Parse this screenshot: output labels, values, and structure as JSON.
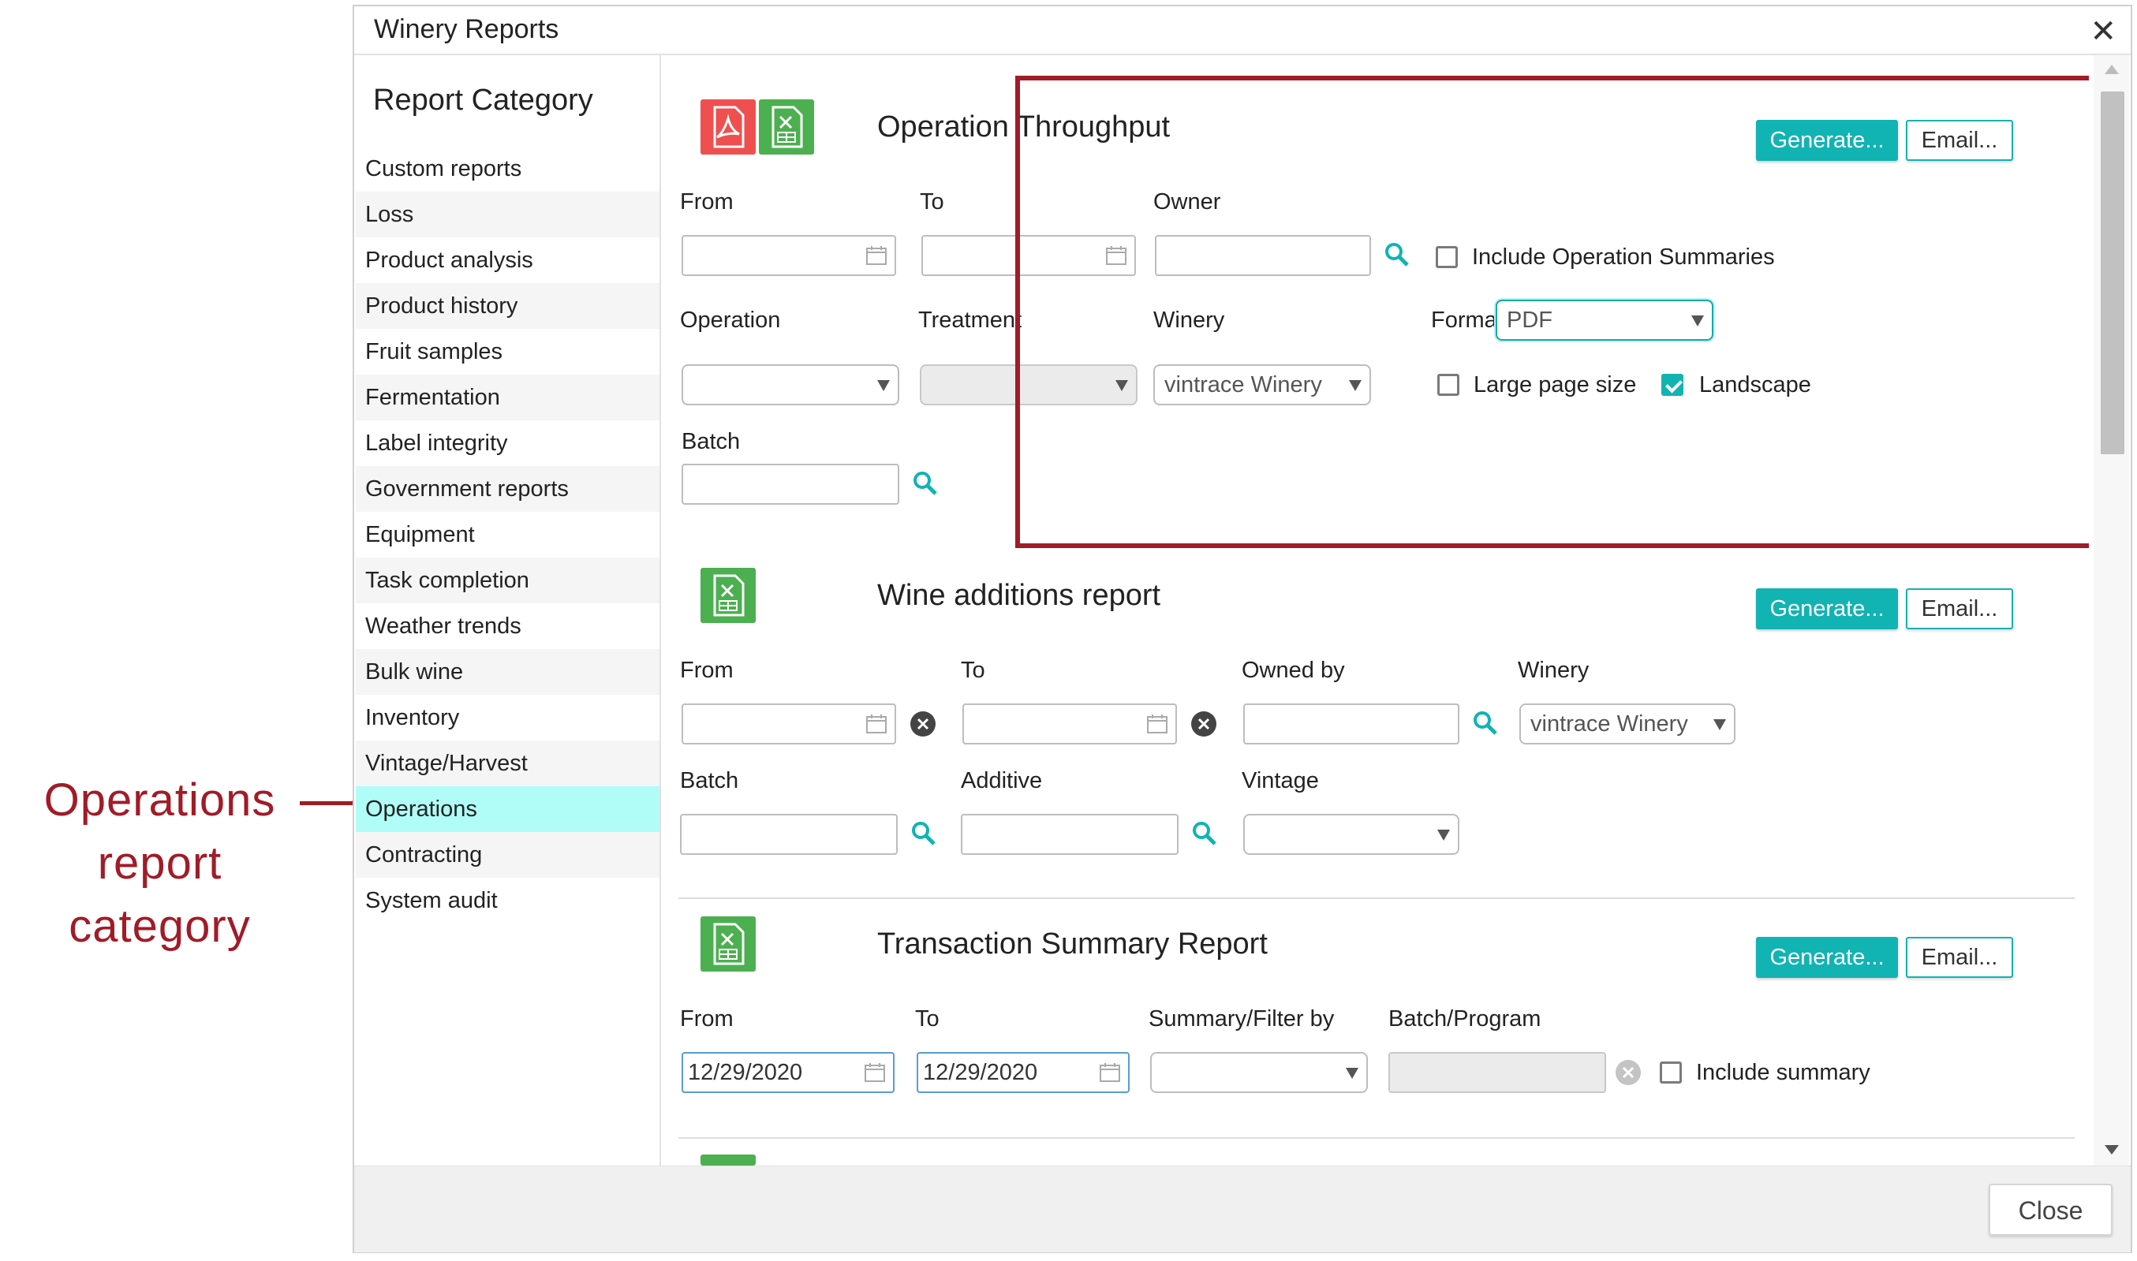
{
  "annotation": {
    "line1": "Operations",
    "line2": "report",
    "line3": "category"
  },
  "dialog": {
    "title": "Winery Reports",
    "close_glyph": "✕",
    "footer_close": "Close"
  },
  "sidebar": {
    "heading": "Report Category",
    "items": [
      {
        "label": "Custom reports"
      },
      {
        "label": "Loss"
      },
      {
        "label": "Product analysis"
      },
      {
        "label": "Product history"
      },
      {
        "label": "Fruit samples"
      },
      {
        "label": "Fermentation"
      },
      {
        "label": "Label integrity"
      },
      {
        "label": "Government reports"
      },
      {
        "label": "Equipment"
      },
      {
        "label": "Task completion"
      },
      {
        "label": "Weather trends"
      },
      {
        "label": "Bulk wine"
      },
      {
        "label": "Inventory"
      },
      {
        "label": "Vintage/Harvest"
      },
      {
        "label": "Operations"
      },
      {
        "label": "Contracting"
      },
      {
        "label": "System audit"
      }
    ],
    "active": "Operations"
  },
  "reports": {
    "op": {
      "title": "Operation Throughput",
      "generate": "Generate...",
      "email": "Email...",
      "from_label": "From",
      "to_label": "To",
      "owner_label": "Owner",
      "include_summaries": "Include Operation Summaries",
      "include_summaries_checked": false,
      "operation_label": "Operation",
      "treatment_label": "Treatment",
      "winery_label": "Winery",
      "winery_value": "vintrace Winery",
      "format_label": "Format:",
      "format_value": "PDF",
      "large_page": "Large page size",
      "large_page_checked": false,
      "landscape": "Landscape",
      "landscape_checked": true,
      "batch_label": "Batch"
    },
    "wine": {
      "title": "Wine additions report",
      "generate": "Generate...",
      "email": "Email...",
      "from_label": "From",
      "to_label": "To",
      "owned_by_label": "Owned by",
      "winery_label": "Winery",
      "winery_value": "vintrace Winery",
      "batch_label": "Batch",
      "additive_label": "Additive",
      "vintage_label": "Vintage"
    },
    "trans": {
      "title": "Transaction Summary Report",
      "generate": "Generate...",
      "email": "Email...",
      "from_label": "From",
      "to_label": "To",
      "from_value": "12/29/2020",
      "to_value": "12/29/2020",
      "summary_label": "Summary/Filter by",
      "batch_program_label": "Batch/Program",
      "include_summary": "Include summary",
      "include_summary_checked": false
    }
  },
  "colors": {
    "accent": "#12b3b3",
    "highlight": "#a01c28",
    "active_bg": "#b0fcf6",
    "pdf": "#ef4f4f",
    "xls": "#4caf50"
  },
  "icons": [
    "pdf-icon",
    "excel-icon",
    "calendar-icon",
    "search-icon",
    "clear-icon",
    "chevron-down-icon",
    "close-icon"
  ]
}
